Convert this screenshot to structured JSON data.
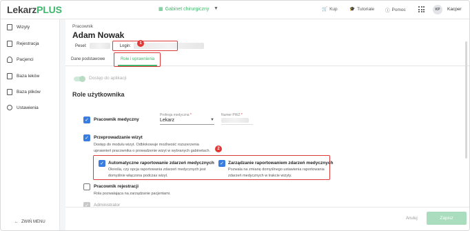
{
  "app": {
    "logo_main": "Lekarz",
    "logo_accent": "PLUS"
  },
  "topbar": {
    "clinic": "Gabinet chirurgiczny",
    "shop": "Kup",
    "tutorials": "Tutoriale",
    "help": "Pomoc",
    "avatar_initials": "KP",
    "username": "Kacper"
  },
  "sidebar": {
    "items": [
      {
        "label": "Wizyty",
        "icon": "clipboard-icon"
      },
      {
        "label": "Rejestracja",
        "icon": "calendar-icon"
      },
      {
        "label": "Pacjenci",
        "icon": "user-icon"
      },
      {
        "label": "Baza leków",
        "icon": "medicine-icon"
      },
      {
        "label": "Baza plików",
        "icon": "file-icon"
      },
      {
        "label": "Ustawienia",
        "icon": "gear-icon"
      }
    ],
    "collapse_label": "ZWIŃ MENU"
  },
  "employee": {
    "breadcrumb": "Pracownik",
    "name": "Adam Nowak",
    "pesel_label": "Pesel:",
    "login_label": "Login:"
  },
  "tabs": [
    {
      "label": "Dane podstawowe"
    },
    {
      "label": "Role i uprawnienia"
    }
  ],
  "access": {
    "label": "Dostęp do aplikacji"
  },
  "roles": {
    "title": "Role użytkownika",
    "medical": {
      "label": "Pracownik medyczny",
      "profession_label": "Profesja medyczna",
      "profession_value": "Lekarz",
      "pwz_label": "Numer PWZ",
      "required_mark": "*"
    },
    "visits": {
      "label": "Przeprowadzanie wizyt",
      "desc_line1": "Dostęp do modułu wizyt. Odblokowuje możliwość rozszerzenia",
      "desc_line2": "uprawnień pracownika o prowadzenie wizyt w wybranych gabinetach."
    },
    "auto_report": {
      "label": "Automatyczne raportowanie zdarzeń medycznych",
      "desc_line1": "Określa, czy opcja raportowania zdarzeń medycznych jest",
      "desc_line2": "domyślnie włączona podczas wizyt."
    },
    "manage_report": {
      "label": "Zarządzanie raportowaniem zdarzeń medycznych",
      "desc_line1": "Pozwala na zmianę domyślnego ustawienia raportowania",
      "desc_line2": "zdarzeń medycznych w trakcie wizyty."
    },
    "registration": {
      "label": "Pracownik rejestracji",
      "desc": "Rola pozwalająca na zarządzanie pacjentami."
    },
    "admin": {
      "label": "Administrator"
    }
  },
  "footer": {
    "cancel": "Anuluj",
    "save": "Zapisz"
  },
  "markers": {
    "one": "1",
    "two": "2"
  },
  "colors": {
    "accent": "#3fb66b",
    "checkbox": "#3a7de0",
    "highlight": "#e03737"
  }
}
